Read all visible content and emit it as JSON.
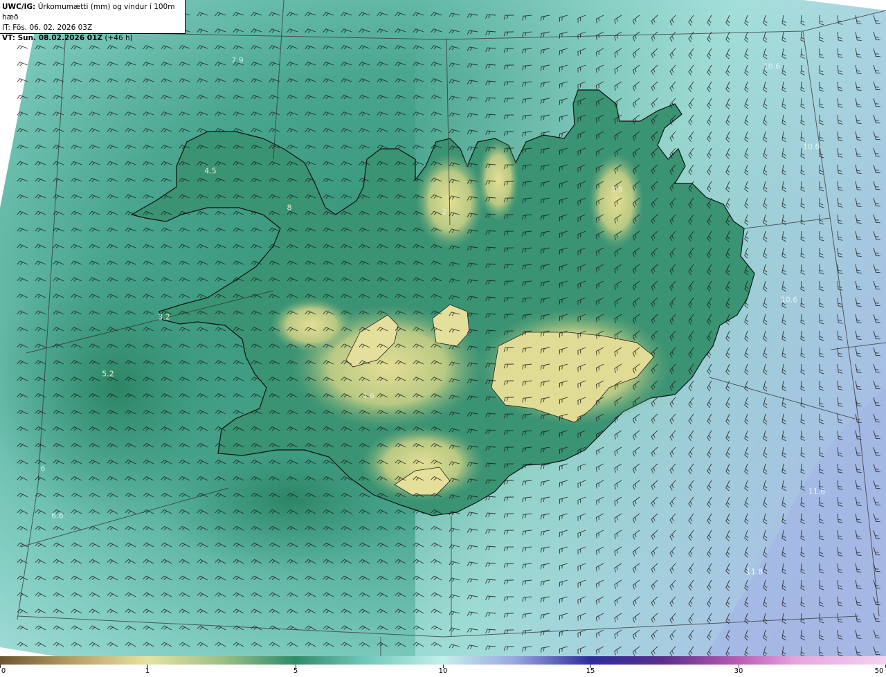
{
  "header": {
    "title_prefix": "UWC/IG:",
    "title_text": "Úrkomumætti (mm) og vindur í 100m hæð",
    "it_line": "IT: Fös. 06. 02. 2026 03Z",
    "vt_prefix": "VT: Sun. 08.02.2026 01Z",
    "vt_suffix": "(+46 h)"
  },
  "map": {
    "value_labels": [
      "7.9",
      "10.6",
      "10.6",
      "4.5",
      "8",
      "2",
      "3.8",
      "3.2",
      "5.2",
      "4.6",
      "6",
      "6.6",
      "10.6",
      "11.6",
      "11.8"
    ]
  },
  "colorbar": {
    "tick_labels": [
      "0",
      "1",
      "5",
      "10",
      "15",
      "30",
      "50"
    ]
  },
  "colors": {
    "sea_teal": "#5bb4a6",
    "land_green": "#2f8a6a",
    "highland_yellow": "#d9d989",
    "ocean_light": "#a8e2df",
    "ocean_blue": "#a9bde6"
  }
}
